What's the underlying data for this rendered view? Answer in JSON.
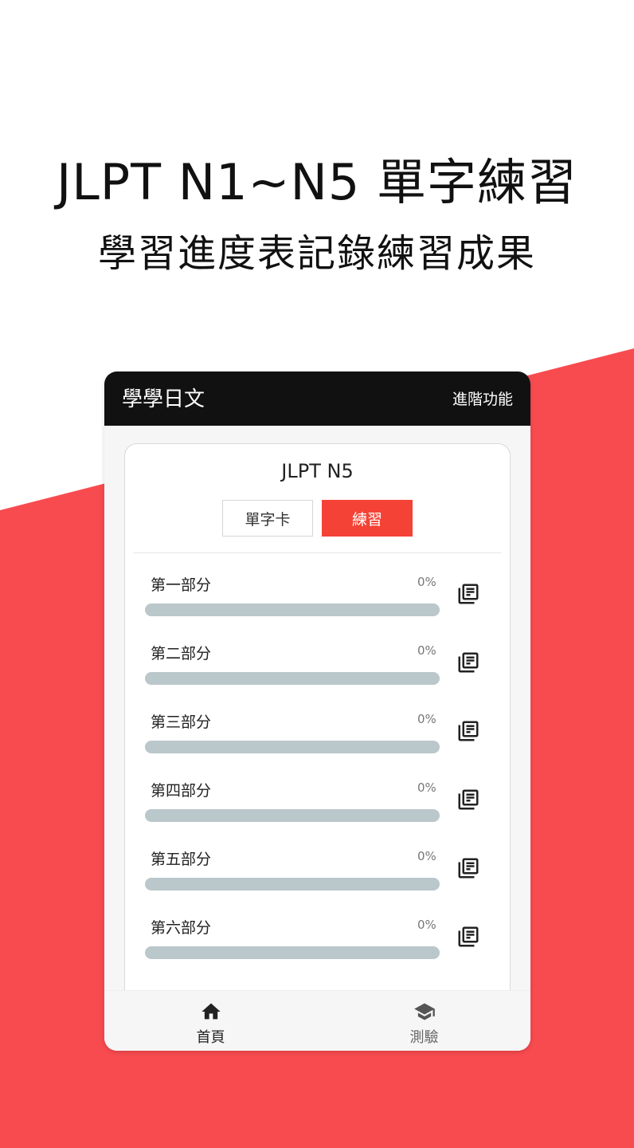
{
  "promo": {
    "headline": "JLPT N1~N5 單字練習",
    "subheadline": "學習進度表記錄練習成果"
  },
  "colors": {
    "accent": "#f44336",
    "background_red": "#f84b4f",
    "appbar": "#111111",
    "progress_track": "#bac7cb"
  },
  "appbar": {
    "title": "學學日文",
    "action": "進階功能"
  },
  "level_card": {
    "title": "JLPT N5",
    "tabs": [
      {
        "label": "單字卡",
        "selected": false
      },
      {
        "label": "練習",
        "selected": true
      }
    ],
    "parts": [
      {
        "name": "第一部分",
        "progress_label": "0%",
        "progress": 0,
        "icon": "library-books-icon"
      },
      {
        "name": "第二部分",
        "progress_label": "0%",
        "progress": 0,
        "icon": "library-books-icon"
      },
      {
        "name": "第三部分",
        "progress_label": "0%",
        "progress": 0,
        "icon": "library-books-icon"
      },
      {
        "name": "第四部分",
        "progress_label": "0%",
        "progress": 0,
        "icon": "library-books-icon"
      },
      {
        "name": "第五部分",
        "progress_label": "0%",
        "progress": 0,
        "icon": "library-books-icon"
      },
      {
        "name": "第六部分",
        "progress_label": "0%",
        "progress": 0,
        "icon": "library-books-icon"
      }
    ]
  },
  "bottom_nav": {
    "items": [
      {
        "label": "首頁",
        "icon": "home-icon",
        "active": true
      },
      {
        "label": "測驗",
        "icon": "school-icon",
        "active": false
      }
    ]
  }
}
